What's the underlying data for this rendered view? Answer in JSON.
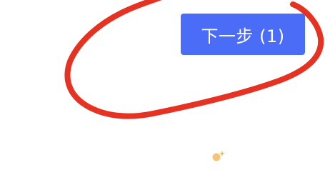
{
  "next_button": {
    "label": "下一步 (1)"
  },
  "colors": {
    "button_background": "#4a6cf7",
    "button_text": "#ffffff",
    "annotation_stroke": "#e53222",
    "cursor_dot": "#f6c37a"
  },
  "icons": {
    "cursor": "sparkle-cursor-icon",
    "annotation": "hand-drawn-circle-annotation"
  }
}
